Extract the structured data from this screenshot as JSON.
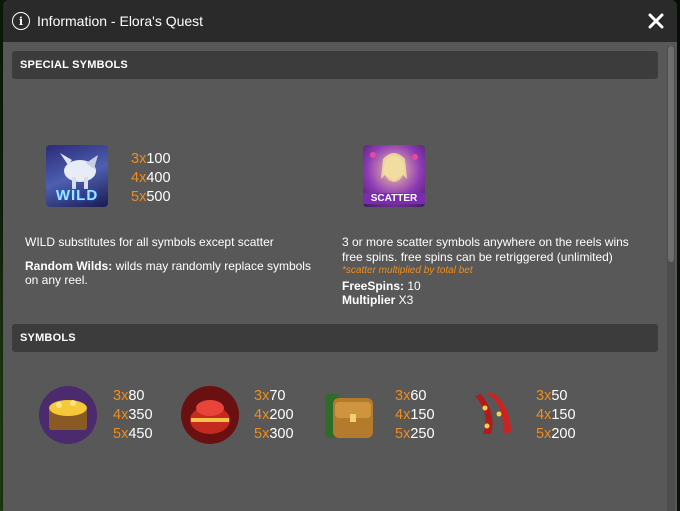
{
  "window": {
    "title": "Information - Elora's Quest"
  },
  "sections": {
    "special": {
      "title": "SPECIAL SYMBOLS"
    },
    "symbols": {
      "title": "SYMBOLS"
    }
  },
  "wild": {
    "icon_label": "WILD",
    "pays": [
      {
        "mult": "3x",
        "value": "100"
      },
      {
        "mult": "4x",
        "value": "400"
      },
      {
        "mult": "5x",
        "value": "500"
      }
    ],
    "description": "WILD substitutes for all symbols except scatter",
    "random_label": "Random Wilds:",
    "random_text": " wilds may randomly replace symbols on any reel."
  },
  "scatter": {
    "icon_label": "SCATTER",
    "description": "3 or more scatter symbols anywhere on the reels wins free spins. free spins can be retriggered (unlimited)",
    "note": "*scatter multiplied by total bet",
    "freespins_label": "FreeSpins:",
    "freespins_value": " 10",
    "multiplier_label": "Multiplier",
    "multiplier_value": " X3"
  },
  "symbols": [
    {
      "name": "treasure-chest",
      "pays": [
        {
          "mult": "3x",
          "value": "80"
        },
        {
          "mult": "4x",
          "value": "350"
        },
        {
          "mult": "5x",
          "value": "450"
        }
      ]
    },
    {
      "name": "red-bowl",
      "pays": [
        {
          "mult": "3x",
          "value": "70"
        },
        {
          "mult": "4x",
          "value": "200"
        },
        {
          "mult": "5x",
          "value": "300"
        }
      ]
    },
    {
      "name": "satchel",
      "pays": [
        {
          "mult": "3x",
          "value": "60"
        },
        {
          "mult": "4x",
          "value": "150"
        },
        {
          "mult": "5x",
          "value": "250"
        }
      ]
    },
    {
      "name": "red-ribbon",
      "pays": [
        {
          "mult": "3x",
          "value": "50"
        },
        {
          "mult": "4x",
          "value": "150"
        },
        {
          "mult": "5x",
          "value": "200"
        }
      ]
    }
  ],
  "colors": {
    "multiplier": "#f08d1d",
    "panel": "#585858",
    "header": "#3c3c3c",
    "titlebar": "#2a2a2a"
  }
}
